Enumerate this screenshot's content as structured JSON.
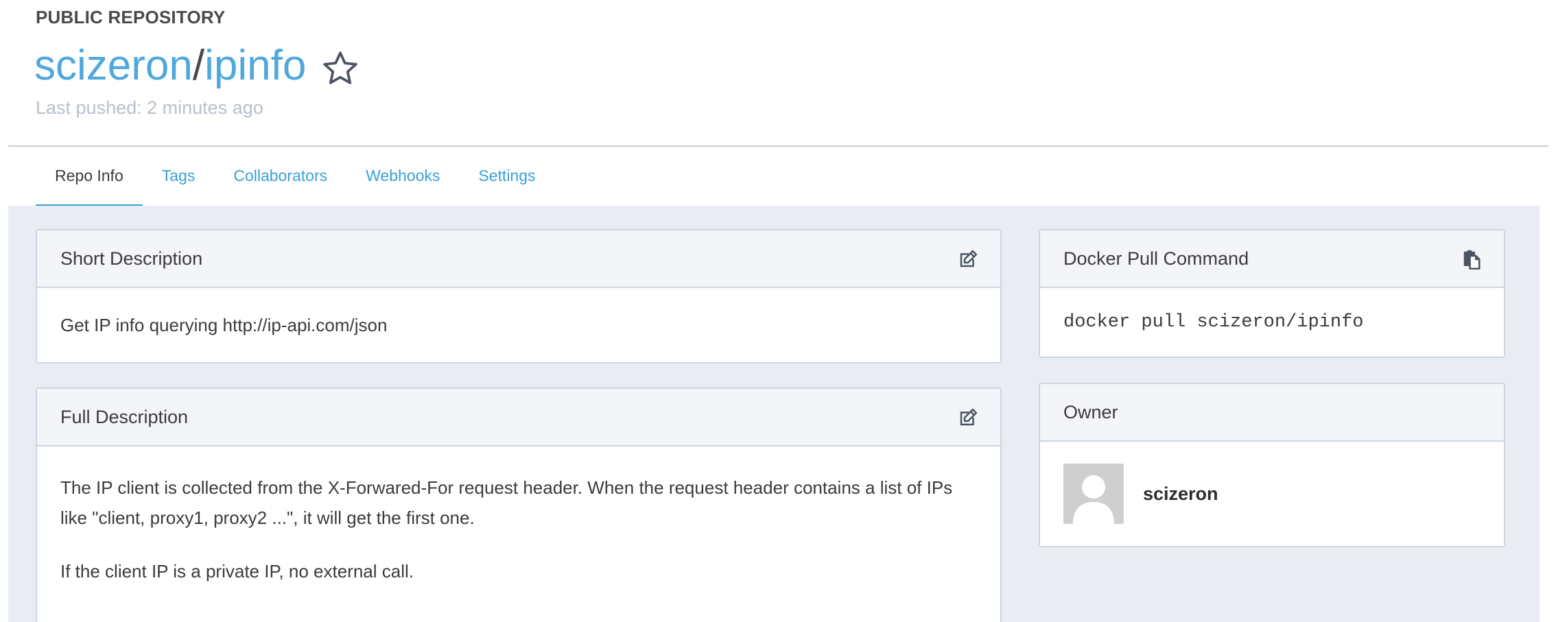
{
  "header": {
    "repo_type": "PUBLIC REPOSITORY",
    "namespace": "scizeron",
    "separator": "/",
    "repo_name": "ipinfo",
    "last_pushed": "Last pushed: 2 minutes ago",
    "star_icon": "star-outline-icon"
  },
  "tabs": [
    {
      "label": "Repo Info",
      "active": true
    },
    {
      "label": "Tags",
      "active": false
    },
    {
      "label": "Collaborators",
      "active": false
    },
    {
      "label": "Webhooks",
      "active": false
    },
    {
      "label": "Settings",
      "active": false
    }
  ],
  "short_description": {
    "title": "Short Description",
    "text": "Get IP info querying http://ip-api.com/json",
    "edit_icon": "edit-icon"
  },
  "full_description": {
    "title": "Full Description",
    "paragraphs": [
      "The IP client is collected from the X-Forwared-For request header. When the request header contains a list of IPs like \"client, proxy1, proxy2 ...\", it will get the first one.",
      "If the client IP is a private IP, no external call."
    ],
    "edit_icon": "edit-icon"
  },
  "pull_command": {
    "title": "Docker Pull Command",
    "command": "docker pull scizeron/ipinfo",
    "copy_icon": "clipboard-icon"
  },
  "owner": {
    "title": "Owner",
    "name": "scizeron",
    "avatar_icon": "default-user-avatar"
  },
  "colors": {
    "link": "#3aa0d8",
    "title_link": "#4fa8dc",
    "muted": "#b7c0cc",
    "content_bg": "#e9edf3"
  }
}
